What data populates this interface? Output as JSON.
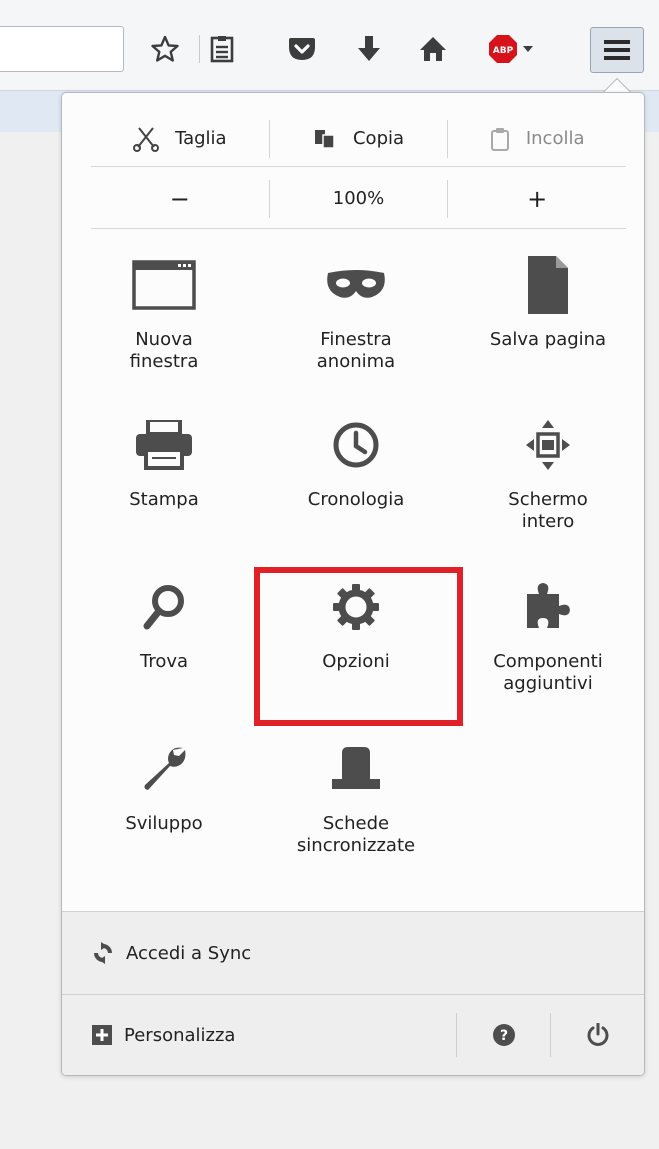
{
  "toolbar": {
    "icons": [
      "bookmark-star-icon",
      "reading-list-icon",
      "pocket-icon",
      "download-icon",
      "home-icon",
      "adblock-plus-icon",
      "menu-icon"
    ],
    "abp_label": "ABP"
  },
  "edit": {
    "cut": "Taglia",
    "copy": "Copia",
    "paste": "Incolla"
  },
  "zoom": {
    "minus": "−",
    "level": "100%",
    "plus": "+"
  },
  "tiles": [
    {
      "label": "Nuova\nfinestra",
      "icon": "new-window-icon"
    },
    {
      "label": "Finestra\nanonima",
      "icon": "private-mask-icon"
    },
    {
      "label": "Salva pagina",
      "icon": "save-page-icon"
    },
    {
      "label": "Stampa",
      "icon": "print-icon"
    },
    {
      "label": "Cronologia",
      "icon": "history-clock-icon"
    },
    {
      "label": "Schermo\nintero",
      "icon": "fullscreen-icon"
    },
    {
      "label": "Trova",
      "icon": "find-icon"
    },
    {
      "label": "Opzioni",
      "icon": "options-gear-icon"
    },
    {
      "label": "Componenti\naggiuntivi",
      "icon": "addons-puzzle-icon"
    },
    {
      "label": "Sviluppo",
      "icon": "developer-wrench-icon"
    },
    {
      "label": "Schede\nsincronizzate",
      "icon": "synced-tabs-icon"
    }
  ],
  "sync": {
    "label": "Accedi a Sync"
  },
  "footer": {
    "customize": "Personalizza"
  },
  "colors": {
    "highlight": "#e02228",
    "icon_gray": "#4d4d4d",
    "abp_red": "#d6131b"
  }
}
